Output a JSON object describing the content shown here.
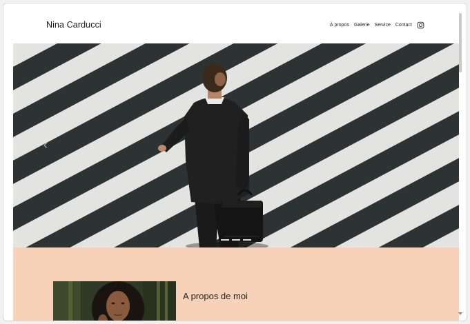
{
  "site": {
    "brand": "Nina Carducci"
  },
  "nav": {
    "items": [
      {
        "label": "À propos"
      },
      {
        "label": "Galerie"
      },
      {
        "label": "Service"
      },
      {
        "label": "Contact"
      }
    ],
    "social_icon": "instagram-icon"
  },
  "hero": {
    "prev_arrow": "‹",
    "slide_count": 3
  },
  "about": {
    "title": "A propos de moi"
  },
  "colors": {
    "about_bg": "#f8d2b8",
    "crosswalk_dark": "#2e3635",
    "crosswalk_light": "#ededeb"
  }
}
